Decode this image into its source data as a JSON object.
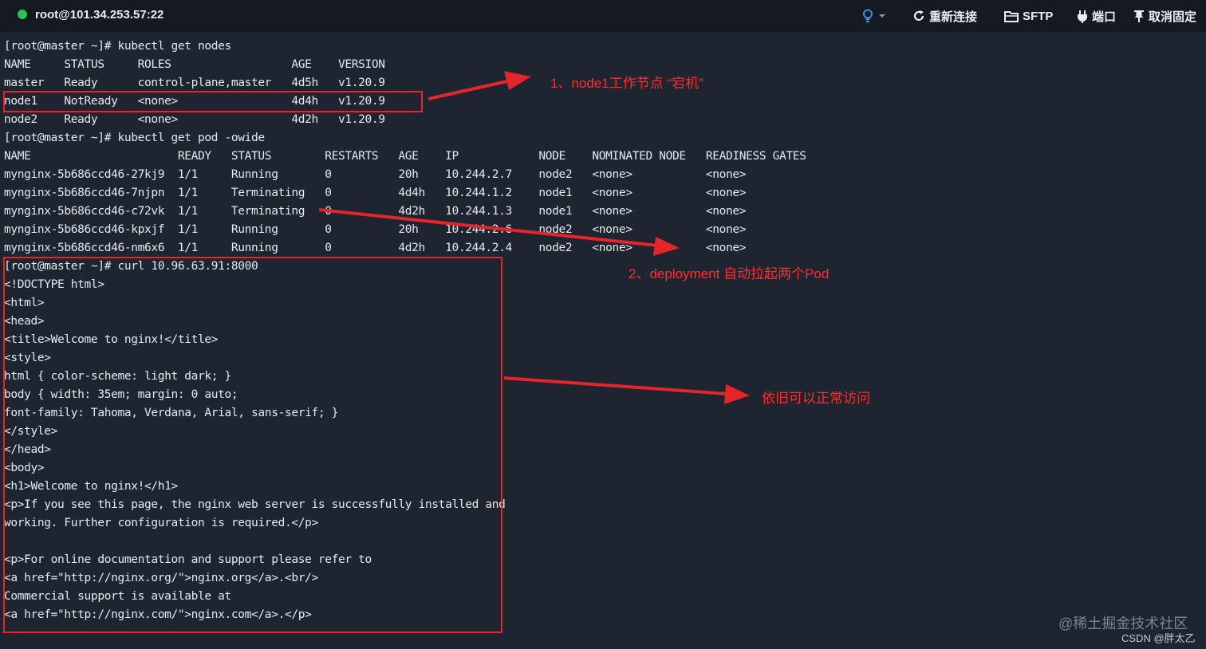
{
  "topbar": {
    "title": "root@101.34.253.57:22",
    "reconnect_label": "重新连接",
    "sftp_label": "SFTP",
    "port_label": "端口",
    "unpin_label": "取消固定",
    "status_color": "#2fbf55",
    "bulb_color": "#3a8ee6"
  },
  "terminal": {
    "lines": [
      "[root@master ~]# kubectl get nodes",
      "NAME     STATUS     ROLES                  AGE    VERSION",
      "master   Ready      control-plane,master   4d5h   v1.20.9",
      "node1    NotReady   <none>                 4d4h   v1.20.9",
      "node2    Ready      <none>                 4d2h   v1.20.9",
      "[root@master ~]# kubectl get pod -owide",
      "NAME                      READY   STATUS        RESTARTS   AGE    IP            NODE    NOMINATED NODE   READINESS GATES",
      "mynginx-5b686ccd46-27kj9  1/1     Running       0          20h    10.244.2.7    node2   <none>           <none>",
      "mynginx-5b686ccd46-7njpn  1/1     Terminating   0          4d4h   10.244.1.2    node1   <none>           <none>",
      "mynginx-5b686ccd46-c72vk  1/1     Terminating   0          4d2h   10.244.1.3    node1   <none>           <none>",
      "mynginx-5b686ccd46-kpxjf  1/1     Running       0          20h    10.244.2.6    node2   <none>           <none>",
      "mynginx-5b686ccd46-nm6x6  1/1     Running       0          4d2h   10.244.2.4    node2   <none>           <none>",
      "[root@master ~]# curl 10.96.63.91:8000",
      "<!DOCTYPE html>",
      "<html>",
      "<head>",
      "<title>Welcome to nginx!</title>",
      "<style>",
      "html { color-scheme: light dark; }",
      "body { width: 35em; margin: 0 auto;",
      "font-family: Tahoma, Verdana, Arial, sans-serif; }",
      "</style>",
      "</head>",
      "<body>",
      "<h1>Welcome to nginx!</h1>",
      "<p>If you see this page, the nginx web server is successfully installed and",
      "working. Further configuration is required.</p>",
      "",
      "<p>For online documentation and support please refer to",
      "<a href=\"http://nginx.org/\">nginx.org</a>.<br/>",
      "Commercial support is available at",
      "<a href=\"http://nginx.com/\">nginx.com</a>.</p>"
    ]
  },
  "annotations": {
    "note1": "1、node1工作节点 “宕机”",
    "note2": "2、deployment 自动拉起两个Pod",
    "note3": "依旧可以正常访问",
    "color": "#e2262a"
  },
  "watermark": {
    "site": "@稀土掘金技术社区",
    "author": "CSDN @胖太乙"
  }
}
